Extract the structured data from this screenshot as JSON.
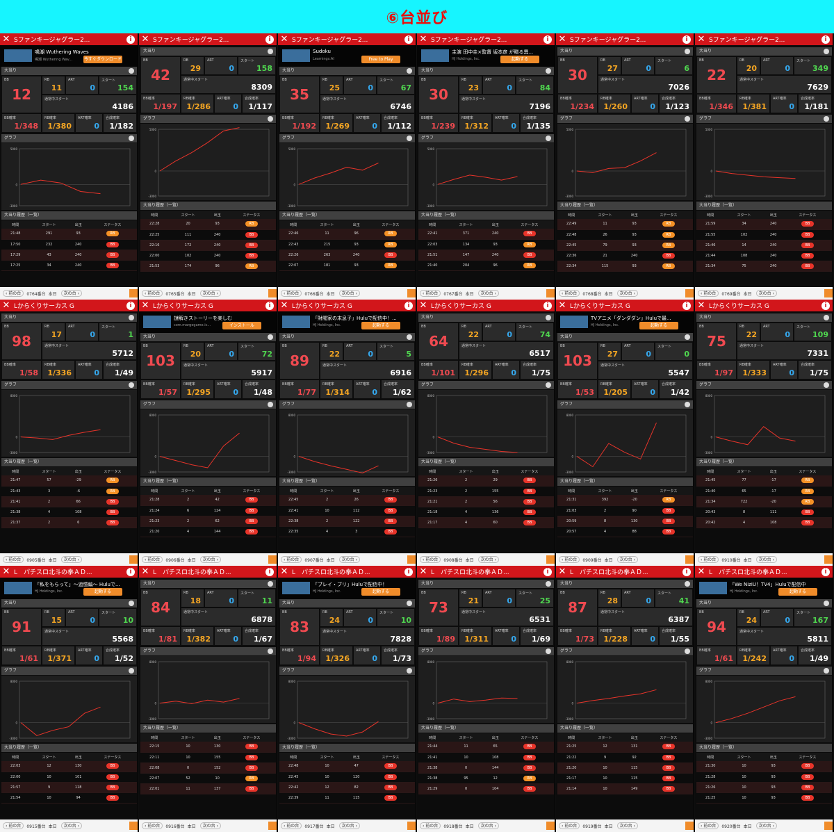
{
  "title": "⑥台並び",
  "labels": {
    "bigwin": "大当り",
    "bb": "BB",
    "rb": "RB",
    "art": "ART",
    "start": "スタート",
    "current_start": "通常中スタート",
    "bb_prob": "BB確率",
    "rb_prob": "RB確率",
    "art_prob": "ART確率",
    "combined": "合成確率",
    "graph": "グラフ",
    "history": "大当り履歴（一覧）",
    "col_time": "時間",
    "col_start": "スタート",
    "col_out": "出玉",
    "col_status": "ステータス",
    "prev": "前の台",
    "today": "本日",
    "next": "次の台",
    "ax_top5000": "5000",
    "ax_zero": "0",
    "ax_bot": "-3000",
    "ax_top8000": "8000"
  },
  "colors": {
    "header_red": "#d2161b",
    "title_bg": "#16f5ff",
    "bb_badge": "#e8342a",
    "rb_badge": "#f59126"
  },
  "panels": [
    {
      "machine": "Sファンキージャグラー2...",
      "ad": {
        "title": "鳴潮 Wuthering Waves",
        "sub": "鳴潮 Wuthering Wav...",
        "btn": "今すぐダウンロード"
      },
      "bb": "12",
      "rb": "11",
      "art": "0",
      "start": "154",
      "cur": "4186",
      "bbp": "1/348",
      "rbp": "1/380",
      "artp": "0",
      "comb": "1/182",
      "foot": "0764番台",
      "graph": [
        0,
        600,
        200,
        -1000,
        -1300
      ],
      "top": "5000",
      "hist": [
        [
          "21:48",
          "291",
          "93",
          "RB"
        ],
        [
          "17:50",
          "232",
          "240",
          "BB"
        ],
        [
          "17:29",
          "43",
          "240",
          "BB"
        ],
        [
          "17:25",
          "34",
          "240",
          "BB"
        ]
      ]
    },
    {
      "machine": "Sファンキージャグラー2...",
      "bb": "42",
      "rb": "29",
      "art": "0",
      "start": "158",
      "cur": "8309",
      "bbp": "1/197",
      "rbp": "1/286",
      "artp": "0",
      "comb": "1/117",
      "foot": "0765番台",
      "graph": [
        0,
        1200,
        2200,
        3400,
        4800,
        5200
      ],
      "top": "5000",
      "hist": [
        [
          "22:28",
          "20",
          "93",
          "RB"
        ],
        [
          "22:25",
          "111",
          "240",
          "BB"
        ],
        [
          "22:16",
          "172",
          "240",
          "BB"
        ],
        [
          "22:00",
          "102",
          "240",
          "BB"
        ],
        [
          "21:53",
          "174",
          "96",
          "RB"
        ]
      ]
    },
    {
      "machine": "Sファンキージャグラー2...",
      "ad": {
        "title": "Sudoku",
        "sub": "Learnings.AI",
        "btn": "Free to Play"
      },
      "bb": "35",
      "rb": "25",
      "art": "0",
      "start": "67",
      "cur": "6746",
      "bbp": "1/192",
      "rbp": "1/269",
      "artp": "0",
      "comb": "1/112",
      "foot": "0766番台",
      "graph": [
        0,
        900,
        1600,
        2400,
        2000,
        3000
      ],
      "top": "5000",
      "hist": [
        [
          "22:46",
          "11",
          "96",
          "RB"
        ],
        [
          "22:43",
          "215",
          "93",
          "RB"
        ],
        [
          "22:26",
          "263",
          "240",
          "BB"
        ],
        [
          "22:07",
          "181",
          "93",
          "RB"
        ]
      ]
    },
    {
      "machine": "Sファンキージャグラー2...",
      "ad": {
        "title": "主演 田中圭×監督 坂本彦 が贈る異...",
        "sub": "HJ Holdings, Inc.",
        "btn": "起動する"
      },
      "bb": "30",
      "rb": "23",
      "art": "0",
      "start": "84",
      "cur": "7196",
      "bbp": "1/239",
      "rbp": "1/312",
      "artp": "0",
      "comb": "1/135",
      "foot": "0767番台",
      "graph": [
        0,
        700,
        1300,
        1000,
        600,
        1100
      ],
      "top": "5000",
      "hist": [
        [
          "22:41",
          "371",
          "240",
          "BB"
        ],
        [
          "22:03",
          "134",
          "93",
          "RB"
        ],
        [
          "21:51",
          "147",
          "240",
          "BB"
        ],
        [
          "21:40",
          "204",
          "96",
          "RB"
        ]
      ]
    },
    {
      "machine": "Sファンキージャグラー2...",
      "bb": "30",
      "rb": "27",
      "art": "0",
      "start": "6",
      "cur": "7026",
      "bbp": "1/234",
      "rbp": "1/260",
      "artp": "0",
      "comb": "1/123",
      "foot": "0768番台",
      "graph": [
        0,
        -200,
        300,
        400,
        1200,
        2200
      ],
      "top": "5000",
      "hist": [
        [
          "22:49",
          "11",
          "93",
          "RB"
        ],
        [
          "22:48",
          "26",
          "93",
          "RB"
        ],
        [
          "22:45",
          "79",
          "93",
          "RB"
        ],
        [
          "22:36",
          "21",
          "240",
          "BB"
        ],
        [
          "22:34",
          "115",
          "93",
          "RB"
        ]
      ]
    },
    {
      "machine": "Sファンキージャグラー2...",
      "bb": "22",
      "rb": "20",
      "art": "0",
      "start": "349",
      "cur": "7629",
      "bbp": "1/346",
      "rbp": "1/381",
      "artp": "0",
      "comb": "1/181",
      "foot": "0769番台",
      "graph": [
        0,
        -300,
        -500,
        -700,
        -800,
        -900
      ],
      "top": "5000",
      "hist": [
        [
          "21:59",
          "34",
          "240",
          "BB"
        ],
        [
          "21:55",
          "102",
          "240",
          "BB"
        ],
        [
          "21:46",
          "14",
          "240",
          "BB"
        ],
        [
          "21:44",
          "108",
          "240",
          "BB"
        ],
        [
          "21:34",
          "75",
          "240",
          "BB"
        ]
      ]
    },
    {
      "machine": "Lからくりサーカス G",
      "bb": "98",
      "rb": "17",
      "art": "0",
      "start": "1",
      "cur": "5712",
      "bbp": "1/58",
      "rbp": "1/336",
      "artp": "0",
      "comb": "1/49",
      "foot": "0905番台",
      "graph": [
        0,
        -200,
        -500,
        300,
        900,
        1400
      ],
      "top": "8000",
      "hist": [
        [
          "21:47",
          "57",
          "-29",
          "RB"
        ],
        [
          "21:43",
          "3",
          "-6",
          "RB"
        ],
        [
          "21:41",
          "2",
          "66",
          "BB"
        ],
        [
          "21:38",
          "4",
          "108",
          "BB"
        ],
        [
          "21:37",
          "2",
          "6",
          "BB"
        ]
      ]
    },
    {
      "machine": "Lからくりサーカス G",
      "ad": {
        "title": "謎解きストーリーを楽しむ",
        "sub": "com.margegame.ic...",
        "btn": "インストール"
      },
      "bb": "103",
      "rb": "20",
      "art": "0",
      "start": "72",
      "cur": "5917",
      "bbp": "1/57",
      "rbp": "1/295",
      "artp": "0",
      "comb": "1/48",
      "foot": "0906番台",
      "graph": [
        0,
        -800,
        -1600,
        -2200,
        2000,
        4500
      ],
      "top": "8000",
      "hist": [
        [
          "21:28",
          "2",
          "42",
          "BB"
        ],
        [
          "21:24",
          "6",
          "124",
          "BB"
        ],
        [
          "21:23",
          "2",
          "62",
          "BB"
        ],
        [
          "21:20",
          "4",
          "144",
          "BB"
        ]
      ]
    },
    {
      "machine": "Lからくりサーカス G",
      "ad": {
        "title": "「財閥家の末息子」Huluで配信中！...",
        "sub": "HJ Holdings, Inc.",
        "btn": "起動する"
      },
      "bb": "89",
      "rb": "22",
      "art": "0",
      "start": "5",
      "cur": "6916",
      "bbp": "1/77",
      "rbp": "1/314",
      "artp": "0",
      "comb": "1/62",
      "foot": "0907番台",
      "graph": [
        0,
        -1000,
        -1800,
        -2500,
        -3200,
        -1800
      ],
      "top": "8000",
      "hist": [
        [
          "22:45",
          "2",
          "26",
          "BB"
        ],
        [
          "22:41",
          "10",
          "112",
          "BB"
        ],
        [
          "22:38",
          "2",
          "122",
          "BB"
        ],
        [
          "22:35",
          "4",
          "3",
          "BB"
        ]
      ]
    },
    {
      "machine": "Lからくりサーカス G",
      "bb": "64",
      "rb": "22",
      "art": "0",
      "start": "74",
      "cur": "6517",
      "bbp": "1/101",
      "rbp": "1/296",
      "artp": "0",
      "comb": "1/75",
      "foot": "0908番台",
      "graph": [
        0,
        -1200,
        -2000,
        -2400,
        -2800,
        -3000
      ],
      "top": "8000",
      "hist": [
        [
          "21:26",
          "2",
          "29",
          "BB"
        ],
        [
          "21:23",
          "2",
          "155",
          "BB"
        ],
        [
          "21:21",
          "2",
          "56",
          "BB"
        ],
        [
          "21:18",
          "4",
          "136",
          "BB"
        ],
        [
          "21:17",
          "4",
          "60",
          "BB"
        ]
      ]
    },
    {
      "machine": "Lからくりサーカス G",
      "ad": {
        "title": "TVアニメ「ダンダダン」Huluで最...",
        "sub": "HJ Holdings, Inc.",
        "btn": "起動する"
      },
      "bb": "103",
      "rb": "27",
      "art": "0",
      "start": "0",
      "cur": "5547",
      "bbp": "1/53",
      "rbp": "1/205",
      "artp": "0",
      "comb": "1/42",
      "foot": "0909番台",
      "graph": [
        0,
        -2000,
        2500,
        800,
        -500,
        6500
      ],
      "top": "8000",
      "hist": [
        [
          "21:31",
          "392",
          "-20",
          "RB"
        ],
        [
          "21:03",
          "2",
          "90",
          "BB"
        ],
        [
          "20:59",
          "8",
          "130",
          "BB"
        ],
        [
          "20:57",
          "4",
          "88",
          "BB"
        ]
      ]
    },
    {
      "machine": "Lからくりサーカス G",
      "bb": "75",
      "rb": "22",
      "art": "0",
      "start": "109",
      "cur": "7331",
      "bbp": "1/97",
      "rbp": "1/333",
      "artp": "0",
      "comb": "1/75",
      "foot": "0910番台",
      "graph": [
        0,
        -800,
        -1500,
        2000,
        -200,
        -800
      ],
      "top": "8000",
      "hist": [
        [
          "21:45",
          "77",
          "-17",
          "RB"
        ],
        [
          "21:40",
          "65",
          "-17",
          "RB"
        ],
        [
          "21:34",
          "722",
          "-20",
          "RB"
        ],
        [
          "20:43",
          "8",
          "111",
          "BB"
        ],
        [
          "20:42",
          "4",
          "108",
          "BB"
        ]
      ]
    },
    {
      "machine": "L　パチスロ北斗の拳ＡＤ...",
      "ad": {
        "title": "「私をもらって」〜追憶編〜 Huluで...",
        "sub": "HJ Holdings, Inc.",
        "btn": "起動する"
      },
      "bb": "91",
      "rb": "15",
      "art": "0",
      "start": "10",
      "cur": "5568",
      "bbp": "1/61",
      "rbp": "1/371",
      "artp": "0",
      "comb": "1/52",
      "foot": "0915番台",
      "graph": [
        0,
        -2500,
        -1500,
        -800,
        1800,
        3000
      ],
      "top": "8000",
      "hist": [
        [
          "22:03",
          "12",
          "130",
          "BB"
        ],
        [
          "22:00",
          "10",
          "101",
          "BB"
        ],
        [
          "21:57",
          "9",
          "118",
          "BB"
        ],
        [
          "21:54",
          "10",
          "94",
          "BB"
        ]
      ]
    },
    {
      "machine": "L　パチスロ北斗の拳ＡＤ...",
      "bb": "84",
      "rb": "18",
      "art": "0",
      "start": "11",
      "cur": "6878",
      "bbp": "1/81",
      "rbp": "1/382",
      "artp": "0",
      "comb": "1/67",
      "foot": "0916番台",
      "graph": [
        0,
        400,
        -100,
        600,
        200,
        900
      ],
      "top": "8000",
      "hist": [
        [
          "22:15",
          "10",
          "130",
          "BB"
        ],
        [
          "22:11",
          "10",
          "155",
          "BB"
        ],
        [
          "22:08",
          "0",
          "152",
          "BB"
        ],
        [
          "22:07",
          "52",
          "10",
          "RB"
        ],
        [
          "22:01",
          "11",
          "137",
          "BB"
        ]
      ]
    },
    {
      "machine": "L　パチスロ北斗の拳ＡＤ...",
      "ad": {
        "title": "「ブレイ・ブリ」Huluで配信中！",
        "sub": "HJ Holdings, Inc.",
        "btn": "起動する"
      },
      "bb": "83",
      "rb": "24",
      "art": "0",
      "start": "10",
      "cur": "7828",
      "bbp": "1/94",
      "rbp": "1/326",
      "artp": "0",
      "comb": "1/73",
      "foot": "0917番台",
      "graph": [
        0,
        -1200,
        -2200,
        -2600,
        -1800,
        200
      ],
      "top": "8000",
      "hist": [
        [
          "22:48",
          "10",
          "47",
          "BB"
        ],
        [
          "22:45",
          "10",
          "120",
          "BB"
        ],
        [
          "22:42",
          "12",
          "82",
          "BB"
        ],
        [
          "22:39",
          "11",
          "115",
          "BB"
        ]
      ]
    },
    {
      "machine": "L　パチスロ北斗の拳ＡＤ...",
      "bb": "73",
      "rb": "21",
      "art": "0",
      "start": "25",
      "cur": "6531",
      "bbp": "1/89",
      "rbp": "1/311",
      "artp": "0",
      "comb": "1/69",
      "foot": "0918番台",
      "graph": [
        0,
        800,
        300,
        600,
        1000,
        900
      ],
      "top": "8000",
      "hist": [
        [
          "21:44",
          "11",
          "65",
          "BB"
        ],
        [
          "21:41",
          "10",
          "108",
          "BB"
        ],
        [
          "21:38",
          "0",
          "144",
          "BB"
        ],
        [
          "21:38",
          "95",
          "12",
          "RB"
        ],
        [
          "21:29",
          "0",
          "104",
          "BB"
        ]
      ]
    },
    {
      "machine": "L　パチスロ北斗の拳ＡＤ...",
      "bb": "87",
      "rb": "28",
      "art": "0",
      "start": "41",
      "cur": "6387",
      "bbp": "1/73",
      "rbp": "1/228",
      "artp": "0",
      "comb": "1/55",
      "foot": "0919番台",
      "graph": [
        0,
        500,
        900,
        1400,
        1800,
        2600
      ],
      "top": "8000",
      "hist": [
        [
          "21:25",
          "12",
          "131",
          "BB"
        ],
        [
          "21:22",
          "9",
          "92",
          "BB"
        ],
        [
          "21:20",
          "10",
          "115",
          "BB"
        ],
        [
          "21:17",
          "10",
          "115",
          "BB"
        ],
        [
          "21:14",
          "10",
          "149",
          "BB"
        ]
      ]
    },
    {
      "machine": "L　パチスロ北斗の拳ＡＤ...",
      "ad": {
        "title": "「We NiziU！TV4」Huluで配信中",
        "sub": "HJ Holdings, Inc.",
        "btn": "起動する"
      },
      "bb": "94",
      "rb": "24",
      "art": "0",
      "start": "167",
      "cur": "5811",
      "bbp": "1/61",
      "rbp": "1/242",
      "artp": "0",
      "comb": "1/49",
      "foot": "0920番台",
      "graph": [
        0,
        800,
        1800,
        3000,
        4200,
        5000
      ],
      "top": "8000",
      "hist": [
        [
          "21:30",
          "10",
          "93",
          "BB"
        ],
        [
          "21:28",
          "10",
          "93",
          "BB"
        ],
        [
          "21:26",
          "10",
          "93",
          "BB"
        ],
        [
          "21:25",
          "10",
          "93",
          "BB"
        ]
      ]
    }
  ]
}
